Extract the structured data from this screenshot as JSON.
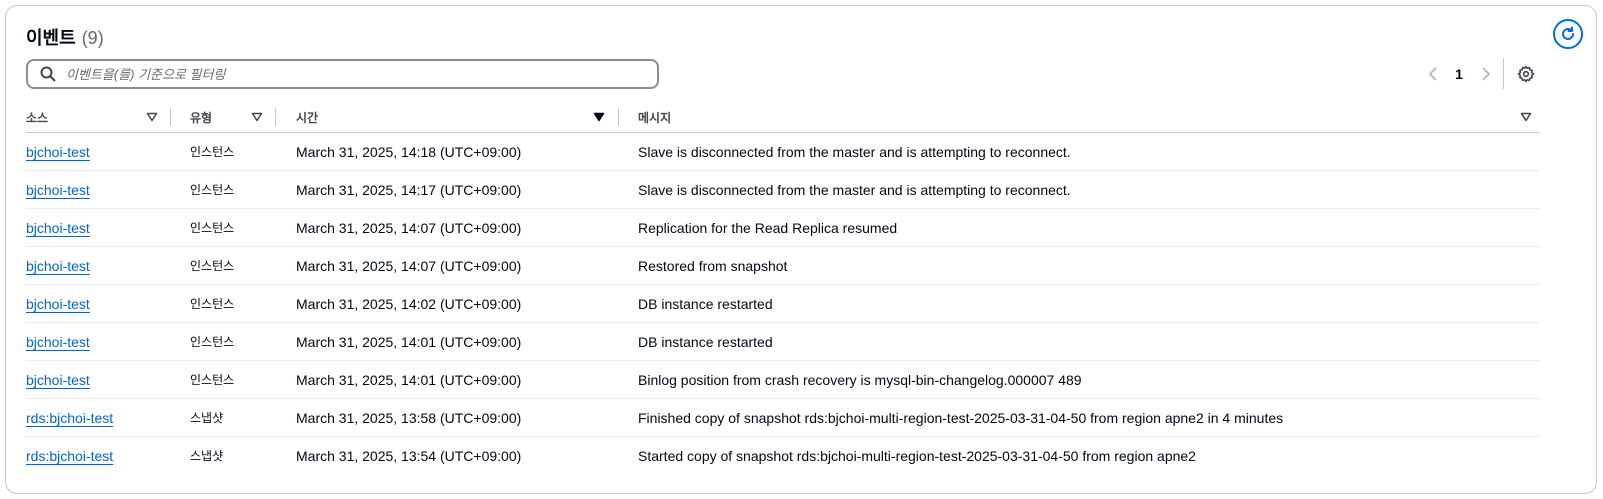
{
  "header": {
    "title": "이벤트",
    "count": "(9)"
  },
  "search": {
    "placeholder": "이벤트을(를) 기준으로 필터링",
    "value": ""
  },
  "pagination": {
    "current_page": "1"
  },
  "icons": {
    "search": "search-icon",
    "refresh": "refresh-icon",
    "settings": "gear-icon",
    "prev": "chevron-left-icon",
    "next": "chevron-right-icon",
    "sort": "caret-down-icon"
  },
  "colors": {
    "link": "#0066cc",
    "accent": "#006ce0"
  },
  "columns": [
    {
      "label": "소스"
    },
    {
      "label": "유형"
    },
    {
      "label": "시간"
    },
    {
      "label": "메시지"
    }
  ],
  "rows": [
    {
      "source": "bjchoi-test",
      "type": "인스턴스",
      "time": "March 31, 2025, 14:18 (UTC+09:00)",
      "message": "Slave is disconnected from the master and is attempting to reconnect."
    },
    {
      "source": "bjchoi-test",
      "type": "인스턴스",
      "time": "March 31, 2025, 14:17 (UTC+09:00)",
      "message": "Slave is disconnected from the master and is attempting to reconnect."
    },
    {
      "source": "bjchoi-test",
      "type": "인스턴스",
      "time": "March 31, 2025, 14:07 (UTC+09:00)",
      "message": "Replication for the Read Replica resumed"
    },
    {
      "source": "bjchoi-test",
      "type": "인스턴스",
      "time": "March 31, 2025, 14:07 (UTC+09:00)",
      "message": "Restored from snapshot"
    },
    {
      "source": "bjchoi-test",
      "type": "인스턴스",
      "time": "March 31, 2025, 14:02 (UTC+09:00)",
      "message": "DB instance restarted"
    },
    {
      "source": "bjchoi-test",
      "type": "인스턴스",
      "time": "March 31, 2025, 14:01 (UTC+09:00)",
      "message": "DB instance restarted"
    },
    {
      "source": "bjchoi-test",
      "type": "인스턴스",
      "time": "March 31, 2025, 14:01 (UTC+09:00)",
      "message": "Binlog position from crash recovery is mysql-bin-changelog.000007 489"
    },
    {
      "source": "rds:bjchoi-test",
      "type": "스냅샷",
      "time": "March 31, 2025, 13:58 (UTC+09:00)",
      "message": "Finished copy of snapshot rds:bjchoi-multi-region-test-2025-03-31-04-50 from region apne2 in 4 minutes"
    },
    {
      "source": "rds:bjchoi-test",
      "type": "스냅샷",
      "time": "March 31, 2025, 13:54 (UTC+09:00)",
      "message": "Started copy of snapshot rds:bjchoi-multi-region-test-2025-03-31-04-50 from region apne2"
    }
  ]
}
